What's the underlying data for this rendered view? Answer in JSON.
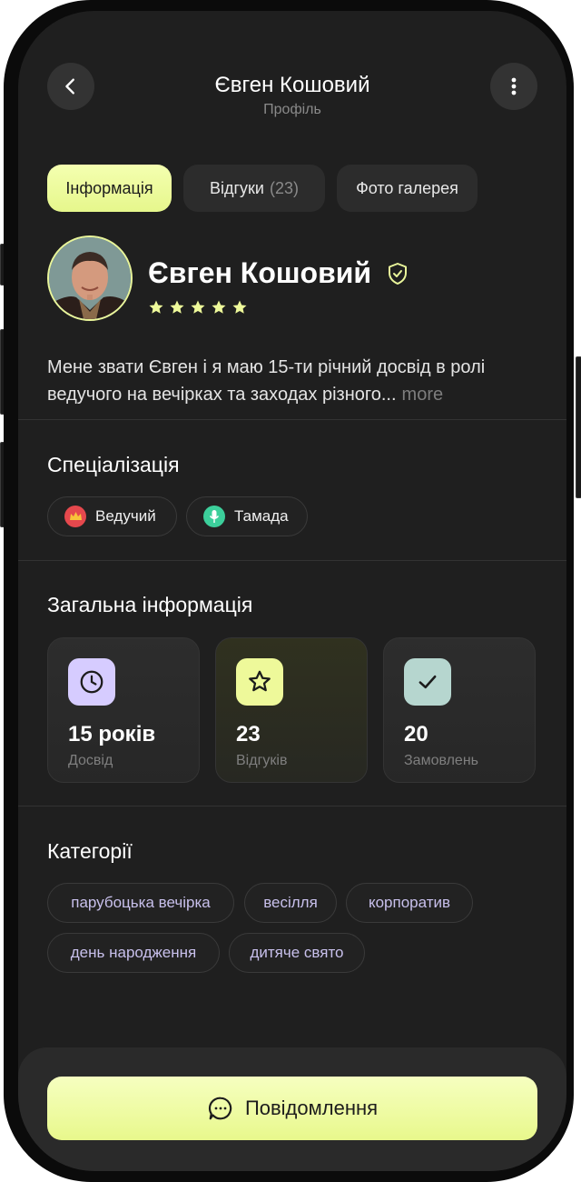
{
  "header": {
    "title": "Євген Кошовий",
    "subtitle": "Профіль"
  },
  "tabs": [
    {
      "label": "Інформація",
      "count": "",
      "active": true
    },
    {
      "label": "Відгуки",
      "count": "(23)",
      "active": false
    },
    {
      "label": "Фото галерея",
      "count": "",
      "active": false
    }
  ],
  "profile": {
    "name": "Євген Кошовий",
    "rating": 5,
    "bio": "Мене звати Євген і я маю 15-ти річний досвід в ролі ведучого на вечірках та заходах різного...",
    "more_label": "more"
  },
  "specialization": {
    "title": "Спеціалізація",
    "items": [
      {
        "label": "Ведучий",
        "icon": "crown-icon",
        "color": "#e5484d"
      },
      {
        "label": "Тамада",
        "icon": "microphone-icon",
        "color": "#3ccf9b"
      }
    ]
  },
  "general": {
    "title": "Загальна інформація",
    "stats": [
      {
        "value": "15 років",
        "label": "Досвід",
        "icon": "clock-icon",
        "color": "#d6ccff"
      },
      {
        "value": "23",
        "label": "Відгуків",
        "icon": "star-icon",
        "color": "#eef99a"
      },
      {
        "value": "20",
        "label": "Замовлень",
        "icon": "check-icon",
        "color": "#b6d6cf"
      }
    ]
  },
  "categories": {
    "title": "Категорії",
    "items": [
      "парубоцька вечірка",
      "весілля",
      "корпоратив",
      "день народження",
      "дитяче свято"
    ]
  },
  "cta": {
    "label": "Повідомлення"
  },
  "colors": {
    "background": "#1f1f1f",
    "accent": "#eef99a",
    "tag_text": "#c8c0ec"
  }
}
